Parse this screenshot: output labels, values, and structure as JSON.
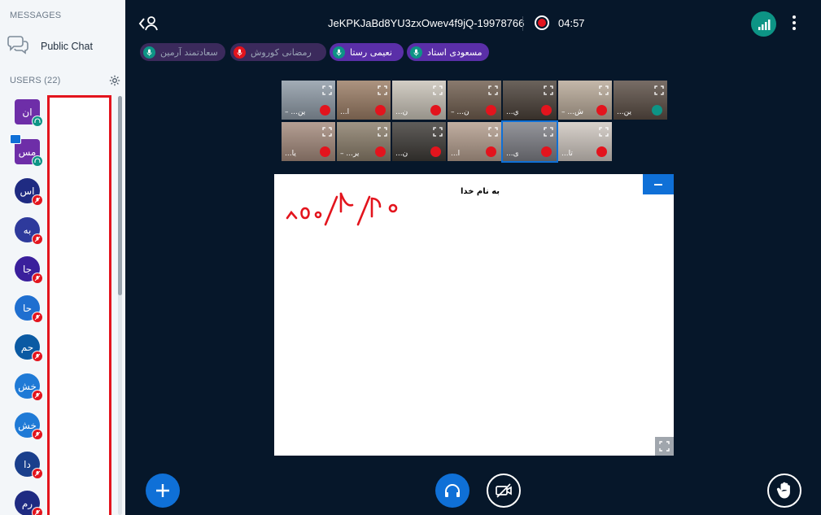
{
  "sidebar": {
    "messages_title": "MESSAGES",
    "public_chat_label": "Public Chat",
    "users_title": "USERS (22)",
    "users": [
      {
        "initials": "ان",
        "color": "#6e2ea8",
        "shape": "square",
        "badge": "audio"
      },
      {
        "initials": "مس",
        "color": "#6e2ea8",
        "shape": "square",
        "badge": "audio",
        "presenter": true
      },
      {
        "initials": "اس",
        "color": "#1f2b82",
        "shape": "circle",
        "badge": "muted"
      },
      {
        "initials": "به",
        "color": "#2e3a9c",
        "shape": "circle",
        "badge": "muted"
      },
      {
        "initials": "جا",
        "color": "#3a1f9c",
        "shape": "circle",
        "badge": "muted"
      },
      {
        "initials": "حا",
        "color": "#1f6fd0",
        "shape": "circle",
        "badge": "muted"
      },
      {
        "initials": "حم",
        "color": "#0b5aa3",
        "shape": "circle",
        "badge": "muted"
      },
      {
        "initials": "خش",
        "color": "#1f7ad6",
        "shape": "circle",
        "badge": "muted"
      },
      {
        "initials": "خش",
        "color": "#1f7ad6",
        "shape": "circle",
        "badge": "muted"
      },
      {
        "initials": "دا",
        "color": "#1a3f8c",
        "shape": "circle",
        "badge": "muted"
      },
      {
        "initials": "رم",
        "color": "#1f2b82",
        "shape": "circle",
        "badge": "muted"
      }
    ]
  },
  "header": {
    "meeting_title": "JeKPKJaBd8YU3zxOwev4f9jQ-19978766",
    "recording_time": "04:57"
  },
  "talkers": [
    {
      "name": "مسعودی استاد",
      "bg": "#5a2fa8",
      "icon_bg": "#0d9485",
      "active": true
    },
    {
      "name": "نعیمی رستا",
      "bg": "#5a2fa8",
      "icon_bg": "#0d9485",
      "active": true
    },
    {
      "name": "رمضانی کوروش",
      "bg": "#3b2a5c",
      "icon_bg": "#e3141d",
      "active": false
    },
    {
      "name": "سعادتمند آرمین",
      "bg": "#3b2a5c",
      "icon_bg": "#0d9485",
      "active": false
    }
  ],
  "videos": [
    {
      "name": "– ...ین",
      "tone": "#8e9aa6",
      "mic": "muted"
    },
    {
      "name": "...ا",
      "tone": "#9a7c64",
      "mic": "muted"
    },
    {
      "name": "...ن",
      "tone": "#c9c3b8",
      "mic": "muted"
    },
    {
      "name": "– ...ن",
      "tone": "#6f5d4e",
      "mic": "muted"
    },
    {
      "name": "...ي",
      "tone": "#4a4038",
      "mic": "muted"
    },
    {
      "name": "– ...ش",
      "tone": "#b7a897",
      "mic": "muted"
    },
    {
      "name": "...ین",
      "tone": "#5a4d44",
      "mic": "audio"
    },
    {
      "name": "...یا",
      "tone": "#a48a7c",
      "mic": "muted"
    },
    {
      "name": "– ...ير",
      "tone": "#8a7d6a",
      "mic": "muted"
    },
    {
      "name": "...ن",
      "tone": "#3d3a36",
      "mic": "muted"
    },
    {
      "name": "...ا",
      "tone": "#b39d8d",
      "mic": "muted"
    },
    {
      "name": "...ی",
      "tone": "#7d7e85",
      "mic": "muted"
    },
    {
      "name": "...تا",
      "tone": "#cfc7c0",
      "mic": "muted"
    }
  ],
  "whiteboard": {
    "title": "به نام خدا",
    "handwriting": "۱۴۰۰/۲/۲۰"
  },
  "colors": {
    "accent": "#0f70d7",
    "teal": "#0d9485",
    "danger": "#e3141d",
    "background": "#06172a"
  }
}
